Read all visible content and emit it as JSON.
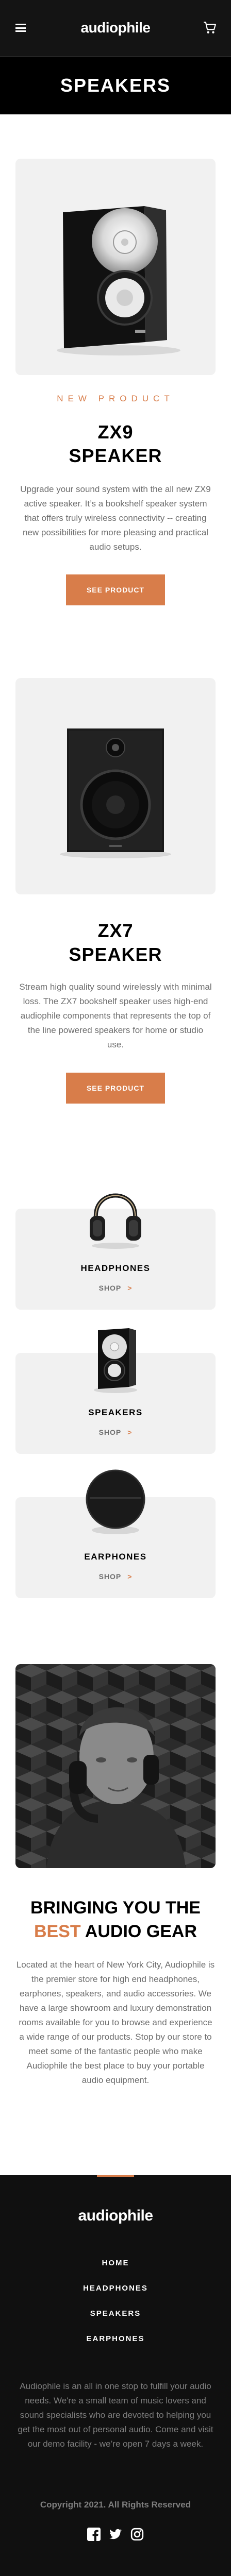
{
  "header": {
    "logo": "audiophile",
    "menu_icon": "hamburger-menu-icon",
    "cart_icon": "shopping-cart-icon"
  },
  "page": {
    "title": "SPEAKERS"
  },
  "products": [
    {
      "overline": "NEW PRODUCT",
      "title_line1": "ZX9",
      "title_line2": "SPEAKER",
      "description": "Upgrade your sound system with the all new ZX9 active speaker. It’s a bookshelf speaker system that offers truly wireless connectivity -- creating new possibilities for more pleasing and practical audio setups.",
      "button": "SEE PRODUCT"
    },
    {
      "title_line1": "ZX7",
      "title_line2": "SPEAKER",
      "description": "Stream high quality sound wirelessly with minimal loss. The ZX7 bookshelf speaker uses high-end audiophile components that represents the top of the line powered speakers for home or studio use.",
      "button": "SEE PRODUCT"
    }
  ],
  "categories": [
    {
      "name": "HEADPHONES",
      "shop": "SHOP"
    },
    {
      "name": "SPEAKERS",
      "shop": "SHOP"
    },
    {
      "name": "EARPHONES",
      "shop": "SHOP"
    }
  ],
  "about": {
    "title_line1": "BRINGING YOU THE",
    "title_accent": "BEST",
    "title_rest": " AUDIO GEAR",
    "text": "Located at the heart of New York City, Audiophile is the premier store for high end headphones, earphones, speakers, and audio accessories. We have a large showroom and luxury demonstration rooms available for you to browse and experience a wide range of our products. Stop by our store to meet some of the fantastic people who make Audiophile the best place to buy your portable audio equipment."
  },
  "footer": {
    "logo": "audiophile",
    "nav": [
      "HOME",
      "HEADPHONES",
      "SPEAKERS",
      "EARPHONES"
    ],
    "description": "Audiophile is an all in one stop to fulfill your audio needs. We're a small team of music lovers and sound specialists who are devoted to helping you get the most out of personal audio. Come and visit our demo facility - we’re open 7 days a week.",
    "copyright": "Copyright 2021. All Rights Reserved",
    "social_icons": [
      "facebook-icon",
      "twitter-icon",
      "instagram-icon"
    ]
  },
  "colors": {
    "accent": "#d87d4a",
    "dark": "#101010",
    "card_bg": "#f1f1f1",
    "muted_text": "#6e6e6e"
  }
}
